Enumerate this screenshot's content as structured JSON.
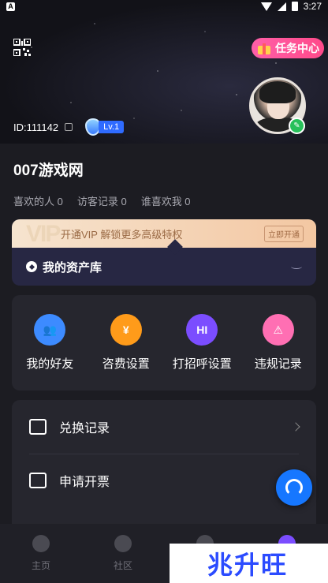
{
  "status_bar": {
    "left_badge": "A",
    "time": "3:27",
    "battery": "2"
  },
  "header": {
    "task_center_label": "任务中心",
    "id_text": "ID:111142",
    "level_label": "Lv.1"
  },
  "profile": {
    "name": "007游戏网",
    "stats": [
      "喜欢的人 0",
      "访客记录 0",
      "谁喜欢我 0"
    ]
  },
  "vip": {
    "watermark": "VIP",
    "promo_text": "开通VIP 解锁更多高级特权",
    "open_label": "立即开通"
  },
  "assets": {
    "title": "我的资产库"
  },
  "shortcuts": [
    {
      "label": "我的好友",
      "icon": "friends-icon",
      "color": "#3d8bff",
      "glyph": "👥"
    },
    {
      "label": "咨费设置",
      "icon": "fee-icon",
      "color": "#ff9b1a",
      "glyph": "¥"
    },
    {
      "label": "打招呼设置",
      "icon": "greeting-icon",
      "color": "#7b4dff",
      "glyph": "HI"
    },
    {
      "label": "违规记录",
      "icon": "violation-icon",
      "color": "#ff6fb3",
      "glyph": "⚠"
    }
  ],
  "list": [
    {
      "label": "兑换记录",
      "icon": "exchange-icon"
    },
    {
      "label": "申请开票",
      "icon": "invoice-icon"
    }
  ],
  "bottom_nav": [
    {
      "label": "主页",
      "icon": "home-icon"
    },
    {
      "label": "社区",
      "icon": "community-icon"
    },
    {
      "label": "",
      "icon": "message-icon"
    },
    {
      "label": "",
      "icon": "profile-icon"
    }
  ],
  "watermark_text": "兆升旺"
}
